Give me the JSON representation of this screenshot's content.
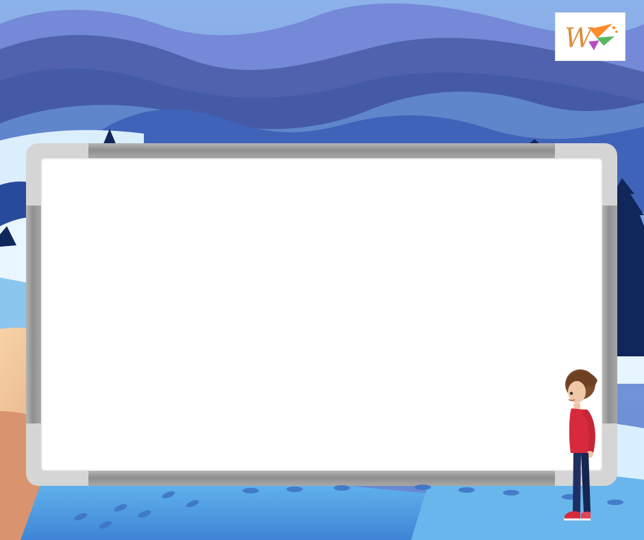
{
  "scene": {
    "logo_icon": "w-logo-icon",
    "board_icon": "whiteboard-icon",
    "child_icon": "standing-child-icon",
    "footprints_icon": "footprints-icon"
  },
  "colors": {
    "sky": "#6d8dd5",
    "mountain_dark": "#4a5ca9",
    "mountain_mid": "#5673c2",
    "snow": "#dceefa",
    "lake": "#5ea9e4",
    "sand": "#f0b983",
    "tree": "#10275b",
    "board_frame": "#9b9b9b",
    "board_surface": "#ffffff",
    "child_shirt": "#d72a3c",
    "child_pants": "#1f2f62",
    "child_hair": "#7b4d2b"
  }
}
